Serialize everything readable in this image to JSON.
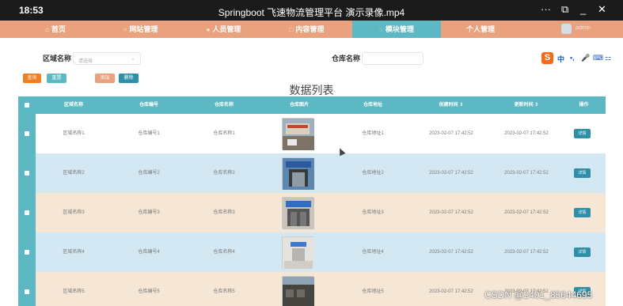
{
  "window": {
    "time": "18:53",
    "title": "Springboot 飞速物流管理平台 演示录像.mp4",
    "more": "···",
    "minimize": "_",
    "close": "✕",
    "restore": "⧉"
  },
  "nav": {
    "items": [
      {
        "label": "首页",
        "icon": "home-icon"
      },
      {
        "label": "网站管理",
        "icon": "web-icon"
      },
      {
        "label": "人员管理",
        "icon": "person-icon"
      },
      {
        "label": "内容管理",
        "icon": "content-icon"
      },
      {
        "label": "模块管理",
        "icon": "module-icon",
        "active": true
      },
      {
        "label": "个人管理",
        "icon": "profile-icon"
      }
    ],
    "user_name": "admin"
  },
  "search": {
    "area_label": "区域名称",
    "area_placeholder": "请选择",
    "warehouse_label": "仓库名称",
    "warehouse_value": ""
  },
  "buttons": {
    "query": "查询",
    "reset": "重置",
    "add": "添加",
    "delete": "删除"
  },
  "ime": {
    "logo": "S",
    "items": [
      "中",
      "•,",
      "🎤",
      "⌨",
      "⚏"
    ]
  },
  "table": {
    "caption": "数据列表",
    "headers": [
      "区域名称",
      "仓库编号",
      "仓库名称",
      "仓库图片",
      "仓库地址",
      "创建时间 ⇕",
      "更新时间 ⇕",
      "操作"
    ],
    "rows": [
      {
        "area": "区域名称1",
        "code": "仓库编号1",
        "name": "仓库名称1",
        "addr": "仓库地址1",
        "created": "2023-02-07 17:42:52",
        "updated": "2023-02-07 17:42:52",
        "action": "详情"
      },
      {
        "area": "区域名称2",
        "code": "仓库编号2",
        "name": "仓库名称2",
        "addr": "仓库地址2",
        "created": "2023-02-07 17:42:52",
        "updated": "2023-02-07 17:42:52",
        "action": "详情"
      },
      {
        "area": "区域名称3",
        "code": "仓库编号3",
        "name": "仓库名称3",
        "addr": "仓库地址3",
        "created": "2023-02-07 17:42:52",
        "updated": "2023-02-07 17:42:52",
        "action": "详情"
      },
      {
        "area": "区域名称4",
        "code": "仓库编号4",
        "name": "仓库名称4",
        "addr": "仓库地址4",
        "created": "2023-02-07 17:42:52",
        "updated": "2023-02-07 17:42:52",
        "action": "详情"
      },
      {
        "area": "区域名称5",
        "code": "仓库编号5",
        "name": "仓库名称5",
        "addr": "仓库地址5",
        "created": "2023-02-07 17:42:52",
        "updated": "2023-02-07 17:42:52",
        "action": "详情"
      }
    ]
  },
  "colors": {
    "nav": "#e9a27d",
    "accent": "#5cb8c2",
    "detail": "#2f8fa8",
    "query": "#ef7d22",
    "reset": "#5cb8c2",
    "add": "#e9a27d",
    "delete": "#2f8fa8"
  },
  "watermark": "CSDN @2401_85644695"
}
